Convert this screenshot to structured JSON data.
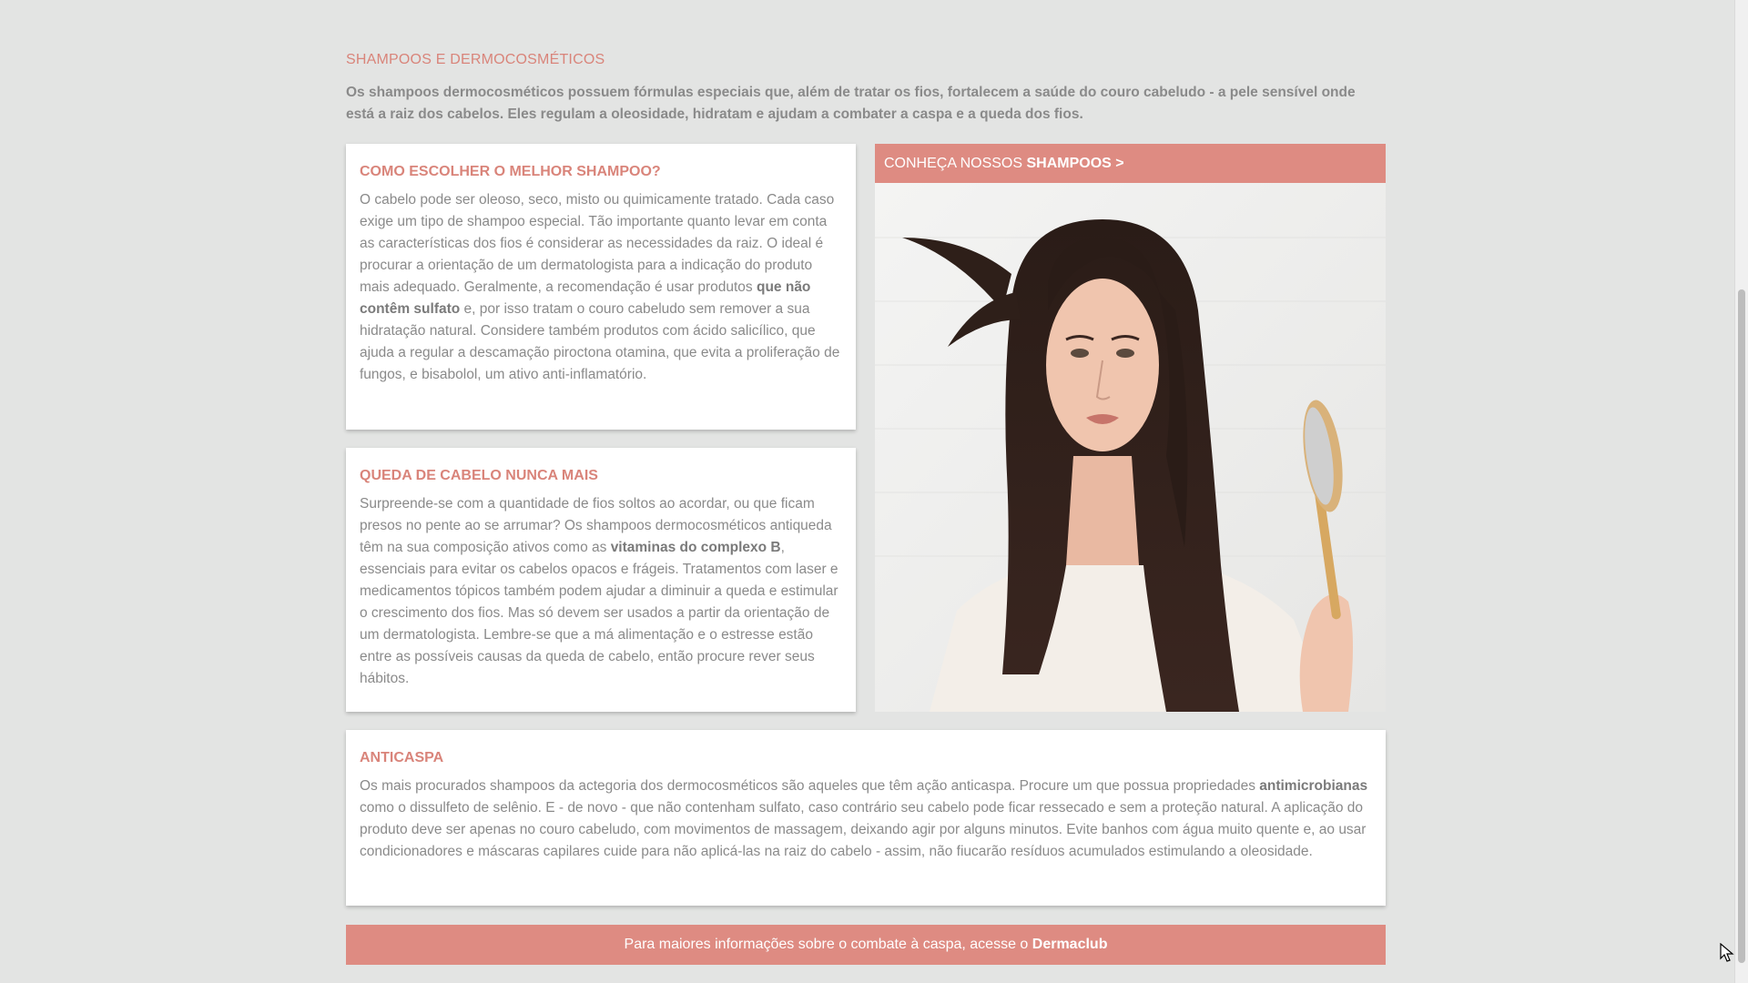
{
  "section": {
    "title": "SHAMPOOS E DERMOCOSMÉTICOS",
    "intro": "Os shampoos dermocosméticos possuem fórmulas especiais que, além de tratar os fios, fortalecem a saúde do couro cabeludo - a pele sensível onde está a raiz dos cabelos. Eles regulam a oleosidade, hidratam e ajudam a combater a caspa e a queda dos fios."
  },
  "cards": {
    "shampoo": {
      "title": "COMO ESCOLHER O MELHOR SHAMPOO?",
      "text_1": "O cabelo pode ser oleoso, seco, misto ou quimicamente tratado. Cada caso exige um tipo de shampoo especial. Tão importante quanto levar em conta as características dos fios é considerar as necessidades da raiz. O ideal é procurar a orientação de um dermatologista para a indicação do produto mais adequado. Geralmente, a recomendação é usar produtos ",
      "bold": "que não contêm sulfato",
      "text_2": " e, por isso tratam o couro cabeludo sem remover a sua hidratação natural. Considere também produtos com ácido salicílico, que ajuda a regular a descamação piroctona otamina, que evita a proliferação de fungos, e bisabolol, um ativo anti-inflamatório."
    },
    "queda": {
      "title": "QUEDA DE CABELO NUNCA MAIS",
      "text_1": "Surpreende-se com a quantidade de fios soltos ao acordar, ou que ficam presos no pente ao se arrumar? Os shampoos dermocosméticos antiqueda têm na sua composição ativos como as ",
      "bold": "vitaminas do complexo B",
      "text_2": ", essenciais para evitar os cabelos opacos e frágeis. Tratamentos com laser e medicamentos tópicos também podem ajudar a diminuir a queda e estimular o crescimento dos fios. Mas só devem ser usados a partir da orientação de um dermatologista. Lembre-se que a má alimentação e o estresse estão entre as possíveis causas da queda de cabelo, então procure rever seus hábitos."
    },
    "anticaspa": {
      "title": "ANTICASPA",
      "text_1": "Os mais procurados shampoos da actegoria dos dermocosméticos são aqueles que têm ação anticaspa. Procure um que possua propriedades ",
      "bold": "antimicrobianas",
      "text_2": " como o dissulfeto de selênio. E - de novo - que não contenham sulfato, caso contrário seu cabelo pode ficar ressecado e sem a proteção natural. A aplicação do produto deve ser apenas no couro cabeludo, com movimentos de massagem, deixando agir por alguns minutos. Evite banhos com água muito quente e, ao usar condicionadores e máscaras capilares cuide para não aplicá-las na raiz do cabelo - assim, não fiucarão resíduos acumulados estimulando a oleosidade."
    }
  },
  "promo": {
    "prefix": "CONHEÇA NOSSOS ",
    "link": "SHAMPOOS >"
  },
  "footer": {
    "text": "Para maiores informações sobre o combate à caspa, acesse o ",
    "link": "Dermaclub"
  },
  "colors": {
    "accent": "#de8b82",
    "heading": "#d9847a",
    "text": "#8a8a8a",
    "background": "#e3e4e3"
  }
}
